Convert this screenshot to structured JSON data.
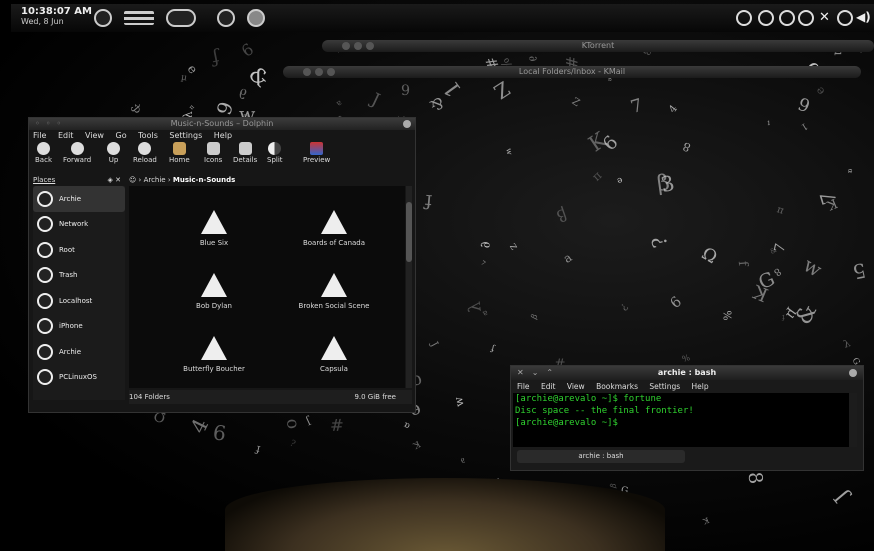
{
  "panel": {
    "time": "10:38:07 AM",
    "date": "Wed, 8 Jun",
    "launcher_icons": [
      "kde-menu-icon",
      "task-icon",
      "activity-icon",
      "desktop-icon",
      "folder-view-icon"
    ],
    "tray_icons": [
      "favorites-icon",
      "info-icon",
      "update-icon",
      "network-icon",
      "close-icon",
      "usb-icon",
      "volume-icon"
    ]
  },
  "minimized": {
    "ktorrent": "KTorrent",
    "kmail": "Local Folders/Inbox - KMail"
  },
  "dolphin": {
    "title": "Music-n-Sounds – Dolphin",
    "menu": [
      "File",
      "Edit",
      "View",
      "Go",
      "Tools",
      "Settings",
      "Help"
    ],
    "toolbar": [
      "Back",
      "Forward",
      "Up",
      "Reload",
      "Home",
      "Icons",
      "Details",
      "Split",
      "Preview"
    ],
    "places_title": "Places",
    "places": [
      "Archie",
      "Network",
      "Root",
      "Trash",
      "Localhost",
      "iPhone",
      "Archie",
      "PCLinuxOS"
    ],
    "breadcrumb_parent": "Archie",
    "breadcrumb_current": "Music-n-Sounds",
    "folders": [
      "Blue Six",
      "Boards of Canada",
      "Bob Dylan",
      "Broken Social Scene",
      "Butterfly Boucher",
      "Capsula"
    ],
    "status_count": "104 Folders",
    "status_free": "9.0 GiB free"
  },
  "konsole": {
    "title": "archie : bash",
    "menu": [
      "File",
      "Edit",
      "View",
      "Bookmarks",
      "Settings",
      "Help"
    ],
    "lines": [
      "[archie@arevalo ~]$ fortune",
      "Disc space -- the final frontier!",
      "[archie@arevalo ~]$"
    ],
    "tab": "archie : bash"
  },
  "wallpaper": {
    "glyphs": [
      "a",
      "Z",
      "#",
      "7",
      "&",
      "1",
      "e",
      "3",
      "G",
      "8",
      "%",
      "ə",
      "K",
      "f",
      "4",
      "J",
      "∂",
      "o",
      "ƒ",
      "5",
      "6",
      "Ω",
      "?",
      "2",
      "α",
      "β",
      "9",
      "λ",
      "w",
      "π",
      "µ"
    ]
  }
}
